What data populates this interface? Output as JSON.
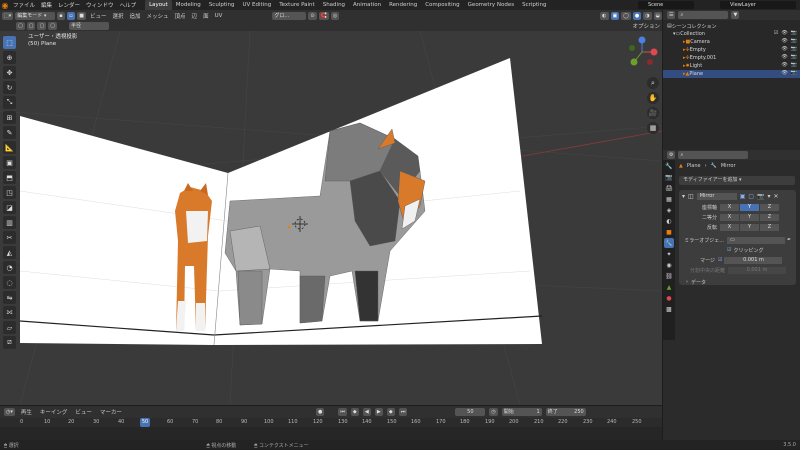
{
  "topbar": {
    "menus": [
      "ファイル",
      "編集",
      "レンダー",
      "ウィンドウ",
      "ヘルプ"
    ],
    "workspaces": [
      "Layout",
      "Modeling",
      "Sculpting",
      "UV Editing",
      "Texture Paint",
      "Shading",
      "Animation",
      "Rendering",
      "Compositing",
      "Geometry Nodes",
      "Scripting"
    ],
    "active_workspace": "Layout",
    "scene": "Scene",
    "viewlayer": "ViewLayer"
  },
  "viewport_header": {
    "mode": "編集モード",
    "menus": [
      "ビュー",
      "選択",
      "追加",
      "メッシュ",
      "頂点",
      "辺",
      "面",
      "UV"
    ],
    "orientation": "グロ...",
    "options": "オプション",
    "transform_mode": "半径"
  },
  "viewport": {
    "view_name": "ユーザー・透視投影",
    "object_info": "(50) Plane"
  },
  "outliner": {
    "header": "シーンコレクション",
    "collection": "Collection",
    "items": [
      {
        "name": "Camera"
      },
      {
        "name": "Empty"
      },
      {
        "name": "Empty.001"
      },
      {
        "name": "Light"
      },
      {
        "name": "Plane"
      }
    ]
  },
  "properties": {
    "breadcrumb_object": "Plane",
    "breadcrumb_modifier": "Mirror",
    "add_modifier": "モディファイアーを追加",
    "modifier_name": "Mirror",
    "rows": [
      {
        "label": "座標軸",
        "axes": [
          "X",
          "Y",
          "Z"
        ]
      },
      {
        "label": "二等分",
        "axes": [
          "X",
          "Y",
          "Z"
        ]
      },
      {
        "label": "反転",
        "axes": [
          "X",
          "Y",
          "Z"
        ]
      }
    ],
    "mirror_object_label": "ミラーオブジェ...",
    "clipping_label": "クリッピング",
    "merge_label": "マージ",
    "merge_value": "0.001 m",
    "bisect_distance_label": "分割中央の距離",
    "bisect_distance_value": "0.001 m",
    "data_label": "データ"
  },
  "timeline": {
    "menus": [
      "再生",
      "キーイング",
      "ビュー",
      "マーカー"
    ],
    "current_frame": "50",
    "start_label": "開始",
    "start_value": "1",
    "end_label": "終了",
    "end_value": "250",
    "ticks": [
      "0",
      "10",
      "20",
      "30",
      "40",
      "50",
      "60",
      "70",
      "80",
      "90",
      "100",
      "110",
      "120",
      "130",
      "140",
      "150",
      "160",
      "170",
      "180",
      "190",
      "200",
      "210",
      "220",
      "230",
      "240",
      "250"
    ]
  },
  "status": {
    "select": "選択",
    "move_view": "視点の移動",
    "context_menu": "コンテクストメニュー",
    "version": "3.5.0"
  },
  "colors": {
    "accent": "#4772b3",
    "blender_orange": "#e87d0d",
    "viewport_bg": "#3a3a3a",
    "dog_orange": "#d97a2b"
  }
}
